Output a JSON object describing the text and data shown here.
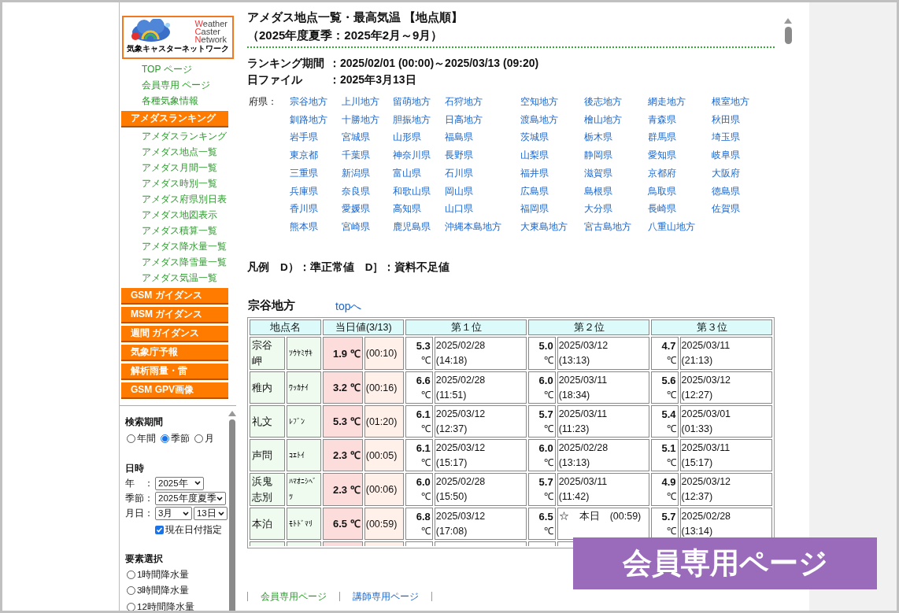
{
  "logo": {
    "lines": [
      "Weather",
      "Caster",
      "Network"
    ],
    "caption": "気象キャスターネットワーク"
  },
  "sidebar": {
    "links": [
      "TOP ページ",
      "会員専用 ページ",
      "各種気象情報"
    ],
    "sections": [
      {
        "label": "アメダスランキング",
        "items": [
          "アメダスランキング",
          "アメダス地点一覧",
          "アメダス月間一覧",
          "アメダス時別一覧",
          "アメダス府県別日表",
          "アメダス地図表示",
          "アメダス積算一覧",
          "アメダス降水量一覧",
          "アメダス降雪量一覧",
          "アメダス気温一覧"
        ]
      },
      {
        "label": "GSM ガイダンス"
      },
      {
        "label": "MSM ガイダンス"
      },
      {
        "label": "週間 ガイダンス"
      },
      {
        "label": "気象庁予報"
      },
      {
        "label": "解析雨量・雷"
      },
      {
        "label": "GSM GPV画像"
      }
    ]
  },
  "search_panel": {
    "period_title": "検索期間",
    "period_options": [
      {
        "label": "年間",
        "selected": false
      },
      {
        "label": "季節",
        "selected": true
      },
      {
        "label": "月",
        "selected": false
      }
    ],
    "datetime_title": "日時",
    "year_label": "年　：",
    "year_value": "2025年",
    "season_label": "季節：",
    "season_value": "2025年度夏季",
    "monthday_label": "月日：",
    "month_value": "3月",
    "day_value": "13日",
    "current_date": {
      "label": "現在日付指定",
      "checked": true
    },
    "element_title": "要素選択",
    "element_options": [
      {
        "label": "1時間降水量",
        "selected": false
      },
      {
        "label": "3時間降水量",
        "selected": false
      },
      {
        "label": "12時間降水量",
        "selected": false
      }
    ]
  },
  "title": [
    "アメダス地点一覧・最高気温 【地点順】",
    "（2025年度夏季：2025年2月～9月）"
  ],
  "info": [
    {
      "label": "ランキング期間",
      "value": "：2025/02/01 (00:00)～2025/03/13 (09:20)"
    },
    {
      "label": "日ファイル",
      "value": "：2025年3月13日"
    }
  ],
  "prefectures": {
    "label": "府県：",
    "links": [
      "宗谷地方",
      "上川地方",
      "留萌地方",
      "石狩地方",
      "空知地方",
      "後志地方",
      "網走地方",
      "根室地方",
      "釧路地方",
      "十勝地方",
      "胆振地方",
      "日高地方",
      "渡島地方",
      "檜山地方",
      "青森県",
      "秋田県",
      "岩手県",
      "宮城県",
      "山形県",
      "福島県",
      "茨城県",
      "栃木県",
      "群馬県",
      "埼玉県",
      "東京都",
      "千葉県",
      "神奈川県",
      "長野県",
      "山梨県",
      "静岡県",
      "愛知県",
      "岐阜県",
      "三重県",
      "新潟県",
      "富山県",
      "石川県",
      "福井県",
      "滋賀県",
      "京都府",
      "大阪府",
      "兵庫県",
      "奈良県",
      "和歌山県",
      "岡山県",
      "広島県",
      "島根県",
      "鳥取県",
      "徳島県",
      "香川県",
      "愛媛県",
      "高知県",
      "山口県",
      "福岡県",
      "大分県",
      "長崎県",
      "佐賀県",
      "熊本県",
      "宮崎県",
      "鹿児島県",
      "沖縄本島地方",
      "大東島地方",
      "宮古島地方",
      "八重山地方"
    ]
  },
  "legend": "凡例　D）：準正常値　D］：資料不足値",
  "region": {
    "heading": "宗谷地方",
    "top_link": "topへ"
  },
  "table": {
    "columns": [
      "地点名",
      "当日値(3/13)",
      "第１位",
      "第２位",
      "第３位"
    ],
    "rows": [
      {
        "name": "宗谷岬",
        "kana": "ｿｳﾔﾐｻｷ",
        "today": "1.9 ℃",
        "today_time": "(00:10)",
        "ranks": [
          {
            "value": "5.3",
            "unit": "℃",
            "date": "2025/02/28",
            "time": "(14:18)"
          },
          {
            "value": "5.0",
            "unit": "℃",
            "date": "2025/03/12",
            "time": "(13:13)"
          },
          {
            "value": "4.7",
            "unit": "℃",
            "date": "2025/03/11",
            "time": "(21:13)"
          }
        ]
      },
      {
        "name": "稚内",
        "kana": "ﾜｯｶﾅｲ",
        "today": "3.2 ℃",
        "today_time": "(00:16)",
        "ranks": [
          {
            "value": "6.6",
            "unit": "℃",
            "date": "2025/02/28",
            "time": "(11:51)"
          },
          {
            "value": "6.0",
            "unit": "℃",
            "date": "2025/03/11",
            "time": "(18:34)"
          },
          {
            "value": "5.6",
            "unit": "℃",
            "date": "2025/03/12",
            "time": "(12:27)"
          }
        ]
      },
      {
        "name": "礼文",
        "kana": "ﾚﾌﾞﾝ",
        "today": "5.3 ℃",
        "today_time": "(01:20)",
        "ranks": [
          {
            "value": "6.1",
            "unit": "℃",
            "date": "2025/03/12",
            "time": "(12:37)"
          },
          {
            "value": "5.7",
            "unit": "℃",
            "date": "2025/03/11",
            "time": "(11:23)"
          },
          {
            "value": "5.4",
            "unit": "℃",
            "date": "2025/03/01",
            "time": "(01:33)"
          }
        ]
      },
      {
        "name": "声問",
        "kana": "ｺｴﾄｲ",
        "today": "2.3 ℃",
        "today_time": "(00:05)",
        "ranks": [
          {
            "value": "6.1",
            "unit": "℃",
            "date": "2025/03/12",
            "time": "(15:17)"
          },
          {
            "value": "6.0",
            "unit": "℃",
            "date": "2025/02/28",
            "time": "(13:13)"
          },
          {
            "value": "5.1",
            "unit": "℃",
            "date": "2025/03/11",
            "time": "(15:17)"
          }
        ]
      },
      {
        "name": "浜鬼志別",
        "kana": "ﾊﾏｵﾆｼﾍﾞﾂ",
        "today": "2.3 ℃",
        "today_time": "(00:06)",
        "ranks": [
          {
            "value": "6.0",
            "unit": "℃",
            "date": "2025/02/28",
            "time": "(15:50)"
          },
          {
            "value": "5.7",
            "unit": "℃",
            "date": "2025/03/11",
            "time": "(11:42)"
          },
          {
            "value": "4.9",
            "unit": "℃",
            "date": "2025/03/12",
            "time": "(12:37)"
          }
        ]
      },
      {
        "name": "本泊",
        "kana": "ﾓﾄﾄﾞﾏﾘ",
        "today": "6.5 ℃",
        "today_time": "(00:59)",
        "ranks": [
          {
            "value": "6.8",
            "unit": "℃",
            "date": "2025/03/12",
            "time": "(17:08)"
          },
          {
            "value": "6.5",
            "unit": "℃",
            "date": "☆　本日　(00:59)"
          },
          {
            "value": "5.7",
            "unit": "℃",
            "date": "2025/02/28",
            "time": "(13:14)"
          }
        ]
      }
    ]
  },
  "footer_links": [
    {
      "label": "会員専用ページ",
      "kind": "member"
    },
    {
      "label": "講師専用ページ",
      "kind": "teacher"
    }
  ],
  "banner": "会員専用ページ"
}
